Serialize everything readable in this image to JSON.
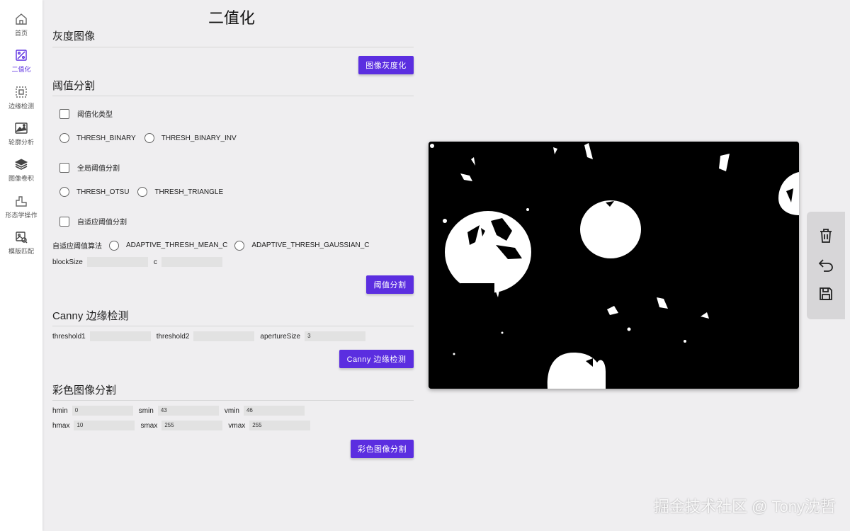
{
  "sidebar": {
    "items": [
      {
        "label": "首页",
        "icon": "home-icon"
      },
      {
        "label": "二值化",
        "icon": "binarize-icon"
      },
      {
        "label": "边缘检测",
        "icon": "edge-detect-icon"
      },
      {
        "label": "轮廓分析",
        "icon": "contour-icon"
      },
      {
        "label": "图像卷积",
        "icon": "layers-icon"
      },
      {
        "label": "形态学操作",
        "icon": "morphology-icon"
      },
      {
        "label": "模版匹配",
        "icon": "template-match-icon"
      }
    ],
    "active_index": 1,
    "accent": "#5b2ee0"
  },
  "page": {
    "title": "二值化"
  },
  "gray": {
    "title": "灰度图像",
    "button": "图像灰度化"
  },
  "threshold": {
    "title": "阈值分割",
    "type_label": "阈值化类型",
    "type_options": [
      "THRESH_BINARY",
      "THRESH_BINARY_INV"
    ],
    "global_label": "全局阈值分割",
    "global_options": [
      "THRESH_OTSU",
      "THRESH_TRIANGLE"
    ],
    "adaptive_label": "自适应阈值分割",
    "adaptive_algo_label": "自适应阈值算法",
    "adaptive_options": [
      "ADAPTIVE_THRESH_MEAN_C",
      "ADAPTIVE_THRESH_GAUSSIAN_C"
    ],
    "block_size_label": "blockSize",
    "block_size_value": "",
    "c_label": "c",
    "c_value": "",
    "button": "阈值分割"
  },
  "canny": {
    "title": "Canny 边缘检测",
    "threshold1_label": "threshold1",
    "threshold1_value": "",
    "threshold2_label": "threshold2",
    "threshold2_value": "",
    "aperture_label": "apertureSize",
    "aperture_value": "3",
    "button": "Canny 边缘检测"
  },
  "color": {
    "title": "彩色图像分割",
    "hmin_label": "hmin",
    "hmin_value": "0",
    "smin_label": "smin",
    "smin_value": "43",
    "vmin_label": "vmin",
    "vmin_value": "46",
    "hmax_label": "hmax",
    "hmax_value": "10",
    "smax_label": "smax",
    "smax_value": "255",
    "vmax_label": "vmax",
    "vmax_value": "255",
    "button": "彩色图像分割"
  },
  "toolbar": {
    "items": [
      "trash-icon",
      "undo-icon",
      "save-icon"
    ]
  },
  "watermark": "掘金技术社区 @ Tony沈哲"
}
